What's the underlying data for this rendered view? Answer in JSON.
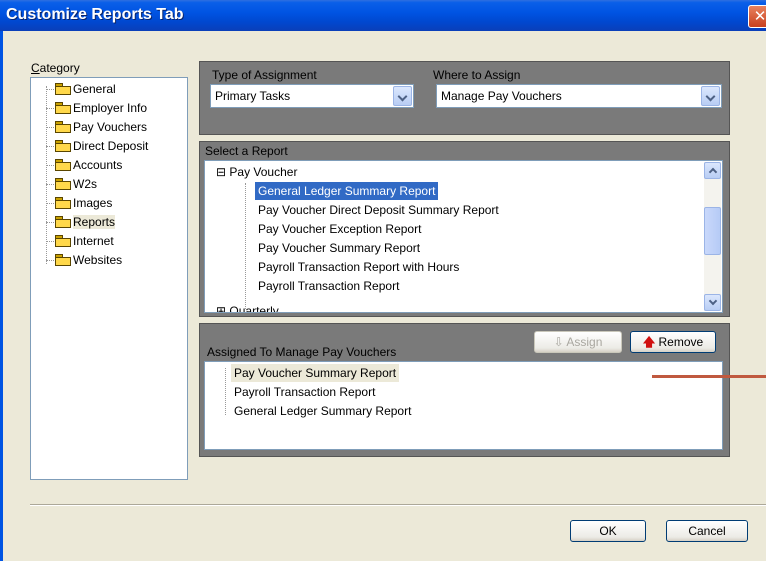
{
  "window": {
    "title": "Customize Reports Tab",
    "close_glyph": "✕"
  },
  "category": {
    "label_prefix": "C",
    "label_rest": "ategory",
    "items": [
      "General",
      "Employer Info",
      "Pay Vouchers",
      "Direct Deposit",
      "Accounts",
      "W2s",
      "Images",
      "Reports",
      "Internet",
      "Websites"
    ],
    "selected": "Reports"
  },
  "assignment": {
    "type_label": "Type of Assignment",
    "type_value": "Primary Tasks",
    "where_label": "Where to Assign",
    "where_value": "Manage Pay Vouchers"
  },
  "select_report": {
    "label": "Select a Report",
    "group": "Pay Voucher",
    "expand_glyph": "⊟",
    "collapsed_glyph": "⊞",
    "items": [
      "General Ledger Summary Report",
      "Pay Voucher Direct Deposit Summary Report",
      "Pay Voucher Exception Report",
      "Pay Voucher Summary Report",
      "Payroll Transaction Report with Hours",
      "Payroll Transaction Report"
    ],
    "selected": "General Ledger Summary Report",
    "next_group": "Quarterly"
  },
  "assigned": {
    "label": "Assigned To Manage Pay Vouchers",
    "assign_label": "Assign",
    "remove_label": "Remove",
    "items": [
      "Pay Voucher Summary Report",
      "Payroll Transaction Report",
      "General Ledger Summary Report"
    ],
    "selected": "Pay Voucher Summary Report"
  },
  "footer": {
    "ok_label": "OK",
    "cancel_label": "Cancel"
  },
  "colors": {
    "titlebar": "#0054e3",
    "selection": "#316ac5",
    "panel": "#7a7a7a",
    "annotation": "#c0593f"
  }
}
